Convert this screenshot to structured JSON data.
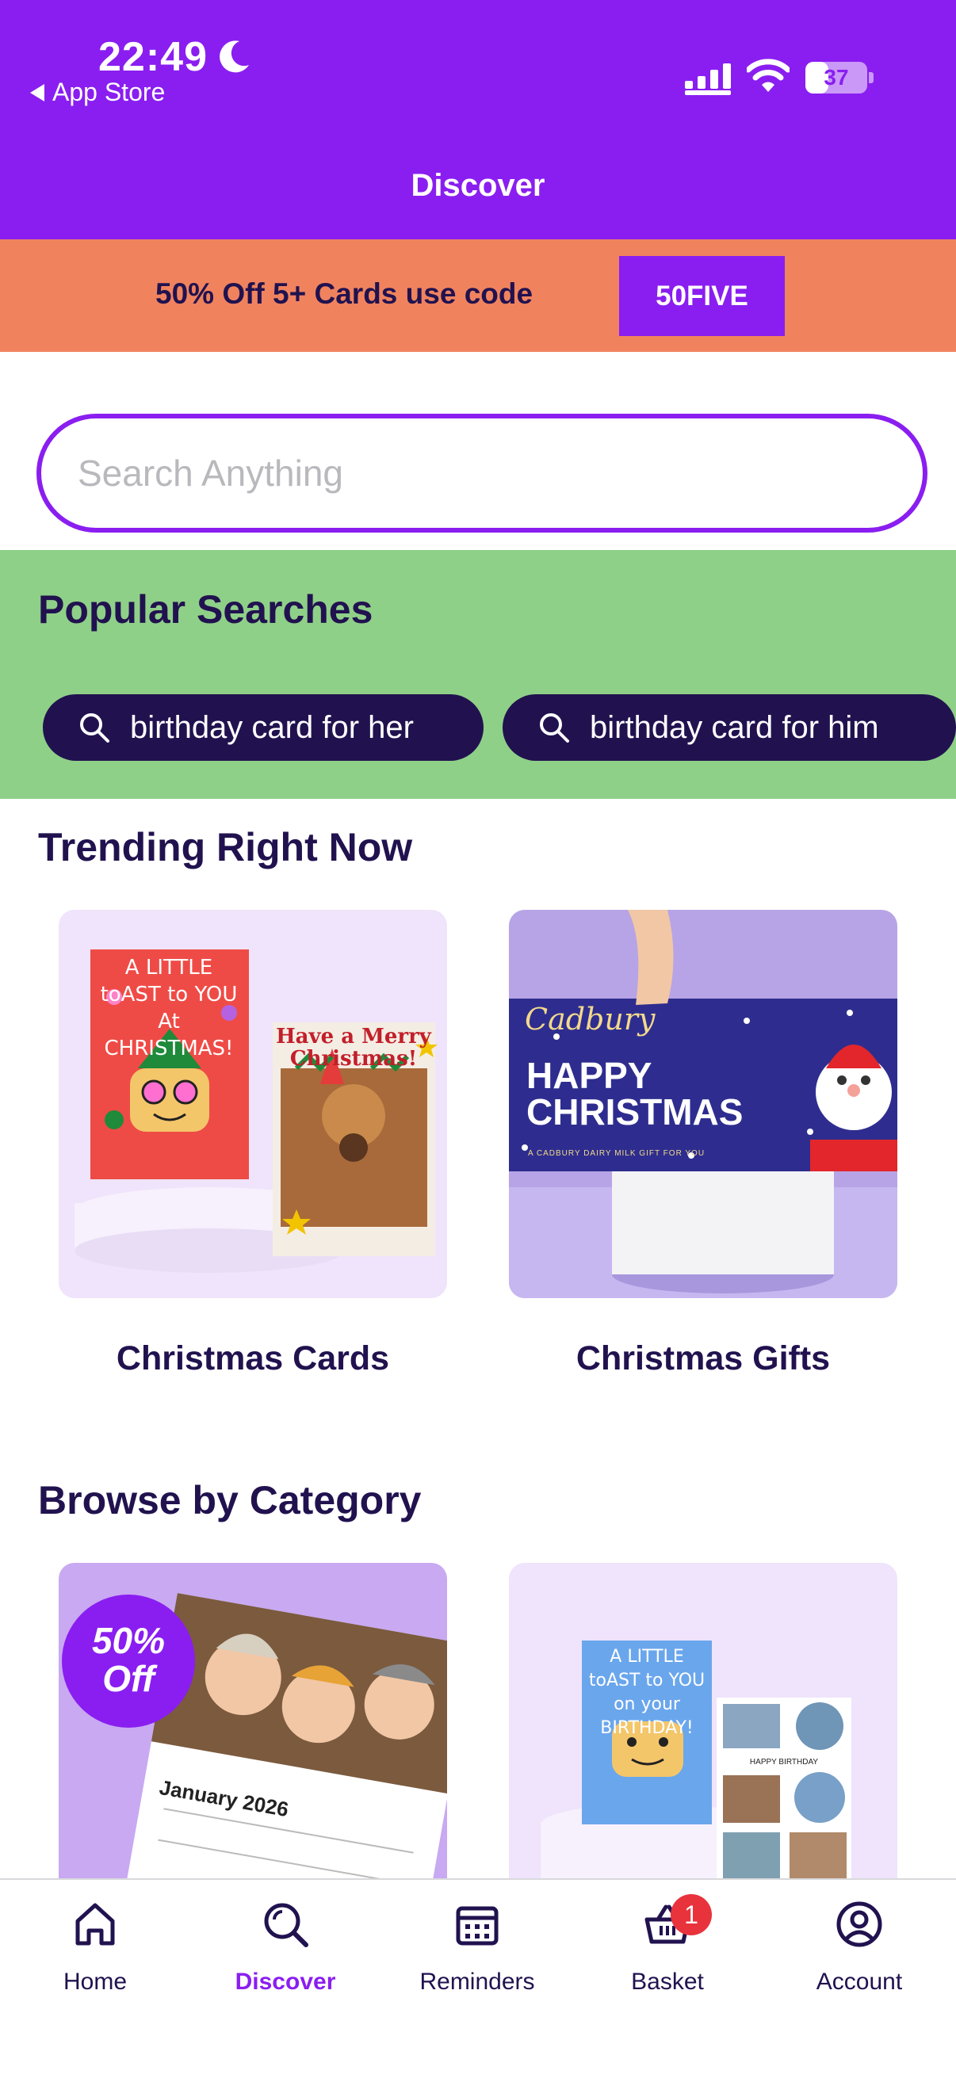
{
  "status_bar": {
    "time": "22:49",
    "back_label": "App Store",
    "battery_level": 37
  },
  "header": {
    "title": "Discover"
  },
  "promo": {
    "text": "50% Off 5+ Cards use code",
    "code": "50FIVE"
  },
  "search": {
    "placeholder": "Search Anything"
  },
  "popular_searches": {
    "title": "Popular Searches",
    "chips": [
      {
        "label": "birthday card for her"
      },
      {
        "label": "birthday card for him"
      }
    ]
  },
  "trending": {
    "title": "Trending Right Now",
    "items": [
      {
        "label": "Christmas Cards",
        "card1_text": "A LITTLE toAST to YOU At CHRISTMAS!",
        "card2_text": "Have a Merry Christmas!"
      },
      {
        "label": "Christmas Gifts",
        "brand": "Cadbury",
        "headline": "HAPPY CHRISTMAS",
        "small_print": "A CADBURY DAIRY MILK GIFT FOR YOU"
      }
    ]
  },
  "browse": {
    "title": "Browse by Category",
    "items": [
      {
        "badge": "50% Off",
        "calendar_month": "January 2026"
      },
      {
        "card_text": "A LITTLE toAST to YOU on your BIRTHDAY!",
        "collage_text": "HAPPY BIRTHDAY"
      }
    ]
  },
  "tabbar": {
    "tabs": [
      {
        "label": "Home",
        "icon": "home-icon"
      },
      {
        "label": "Discover",
        "icon": "discover-icon",
        "active": true
      },
      {
        "label": "Reminders",
        "icon": "calendar-icon"
      },
      {
        "label": "Basket",
        "icon": "basket-icon",
        "badge": "1"
      },
      {
        "label": "Account",
        "icon": "account-icon"
      }
    ]
  },
  "colors": {
    "brand_purple": "#8a1ef0",
    "promo_orange": "#f0835e",
    "popular_green": "#8fd088",
    "navy": "#21124f",
    "badge_red": "#e8333d"
  }
}
